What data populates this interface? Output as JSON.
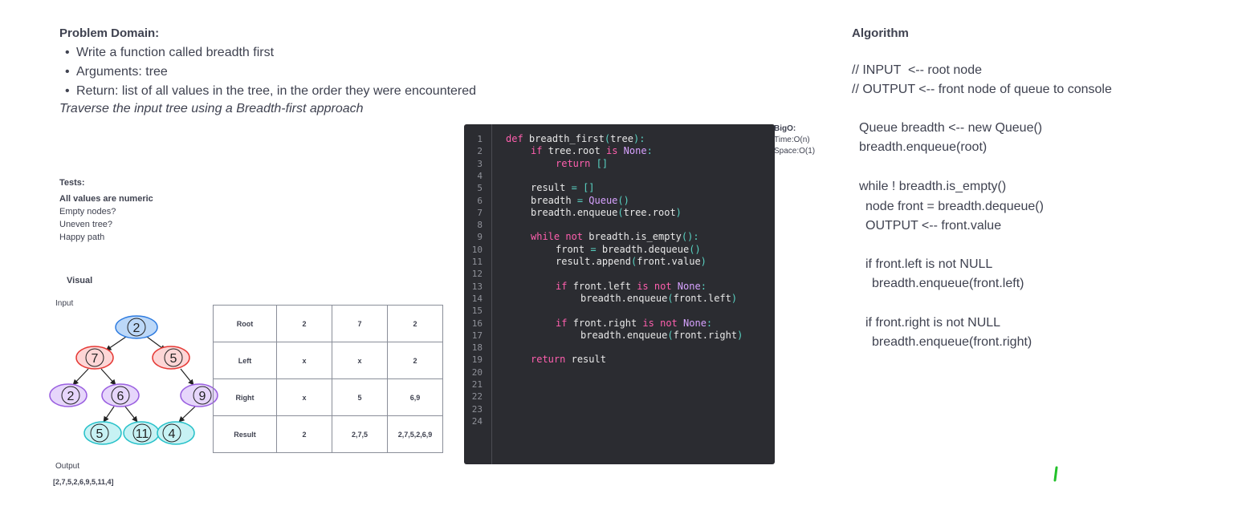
{
  "problem": {
    "title": "Problem Domain:",
    "bullets": [
      "Write a function called breadth first",
      "Arguments: tree",
      "Return: list of all values in the tree, in the order they were encountered"
    ],
    "note": "Traverse the input tree using a Breadth-first approach"
  },
  "tests": {
    "title": "Tests:",
    "items": [
      "All values are numeric",
      "Empty nodes?",
      "Uneven tree?",
      "Happy path"
    ]
  },
  "visual": {
    "title": "Visual",
    "input_label": "Input",
    "output_label": "Output",
    "output_value": "[2,7,5,2,6,9,5,11,4]",
    "tree_nodes": [
      "2",
      "7",
      "5",
      "2",
      "6",
      "9",
      "5",
      "11",
      "4"
    ],
    "colors": {
      "blue": "#2f7ce0",
      "red": "#e53935",
      "purple": "#9a5fe0",
      "teal": "#27c1c9",
      "edge": "#222222"
    }
  },
  "table": {
    "rows": [
      {
        "label": "Root",
        "cells": [
          "2",
          "7",
          "2"
        ]
      },
      {
        "label": "Left",
        "cells": [
          "x",
          "x",
          "2"
        ]
      },
      {
        "label": "Right",
        "cells": [
          "x",
          "5",
          "6,9"
        ]
      },
      {
        "label": "Result",
        "cells": [
          "2",
          "2,7,5",
          "2,7,5,2,6,9"
        ]
      }
    ]
  },
  "code": {
    "line_numbers": [
      "1",
      "2",
      "3",
      "4",
      "5",
      "6",
      "7",
      "8",
      "9",
      "10",
      "11",
      "12",
      "13",
      "14",
      "15",
      "16",
      "17",
      "18",
      "19",
      "20",
      "21",
      "22",
      "23",
      "24"
    ],
    "lines": [
      "def breadth_first(tree):",
      "if tree.root is None:",
      "return []",
      "",
      "result = []",
      "breadth = Queue()",
      "breadth.enqueue(tree.root)",
      "",
      "while not breadth.is_empty():",
      "front = breadth.dequeue()",
      "result.append(front.value)",
      "",
      "if front.left is not None:",
      "breadth.enqueue(front.left)",
      "",
      "if front.right is not None:",
      "breadth.enqueue(front.right)",
      "",
      "return result",
      "",
      "",
      "",
      "",
      ""
    ]
  },
  "bigo": {
    "title": "BigO:",
    "time": "Time:O(n)",
    "space": "Space:O(1)"
  },
  "algorithm": {
    "title": "Algorithm",
    "lines": [
      "// INPUT  <-- root node",
      "// OUTPUT <-- front node of queue to console",
      "Queue breadth <-- new Queue()",
      "breadth.enqueue(root)",
      "while ! breadth.is_empty()",
      "node front = breadth.dequeue()",
      "OUTPUT <-- front.value",
      "if front.left is not NULL",
      "breadth.enqueue(front.left)",
      "if front.right is not NULL",
      "breadth.enqueue(front.right)"
    ]
  },
  "annotation": {
    "color": "#22c12a"
  }
}
